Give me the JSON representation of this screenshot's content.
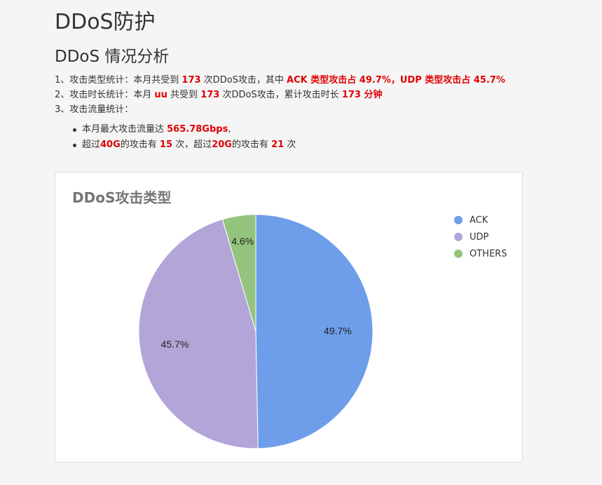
{
  "page": {
    "title": "DDoS防护",
    "subtitle": "DDoS 情况分析"
  },
  "summary": {
    "line1": {
      "a": "1、攻击类型统计：本月共受到 ",
      "b": "173",
      "c": " 次DDoS攻击，其中 ",
      "d": "ACK 类型攻击占 49.7%，UDP 类型攻击占 45.7%"
    },
    "line2": {
      "a": "2、攻击时长统计：本月 ",
      "b": "uu",
      "c": " 共受到 ",
      "d": "173",
      "e": " 次DDoS攻击，累计攻击时长 ",
      "f": "173 分钟"
    },
    "line3": {
      "a": "3、攻击流量统计："
    },
    "bullet1": {
      "a": "本月最大攻击流量达 ",
      "b": "565.78Gbps",
      "c": ","
    },
    "bullet2": {
      "a": "超过",
      "b": "40G",
      "c": "的攻击有 ",
      "d": "15",
      "e": " 次，超过",
      "f": "20G",
      "g": "的攻击有 ",
      "h": "21",
      "i": " 次"
    }
  },
  "colors": {
    "ACK": "#6e9eea",
    "UDP": "#b3a5d8",
    "OTHERS": "#93c47d",
    "highlight": "#e00000"
  },
  "chart_data": {
    "type": "pie",
    "title": "DDoS攻击类型",
    "categories": [
      "ACK",
      "UDP",
      "OTHERS"
    ],
    "values": [
      49.7,
      45.7,
      4.6
    ],
    "labels": [
      "49.7%",
      "45.7%",
      "4.6%"
    ],
    "legend_position": "right",
    "start_angle": "12 o'clock, clockwise"
  }
}
